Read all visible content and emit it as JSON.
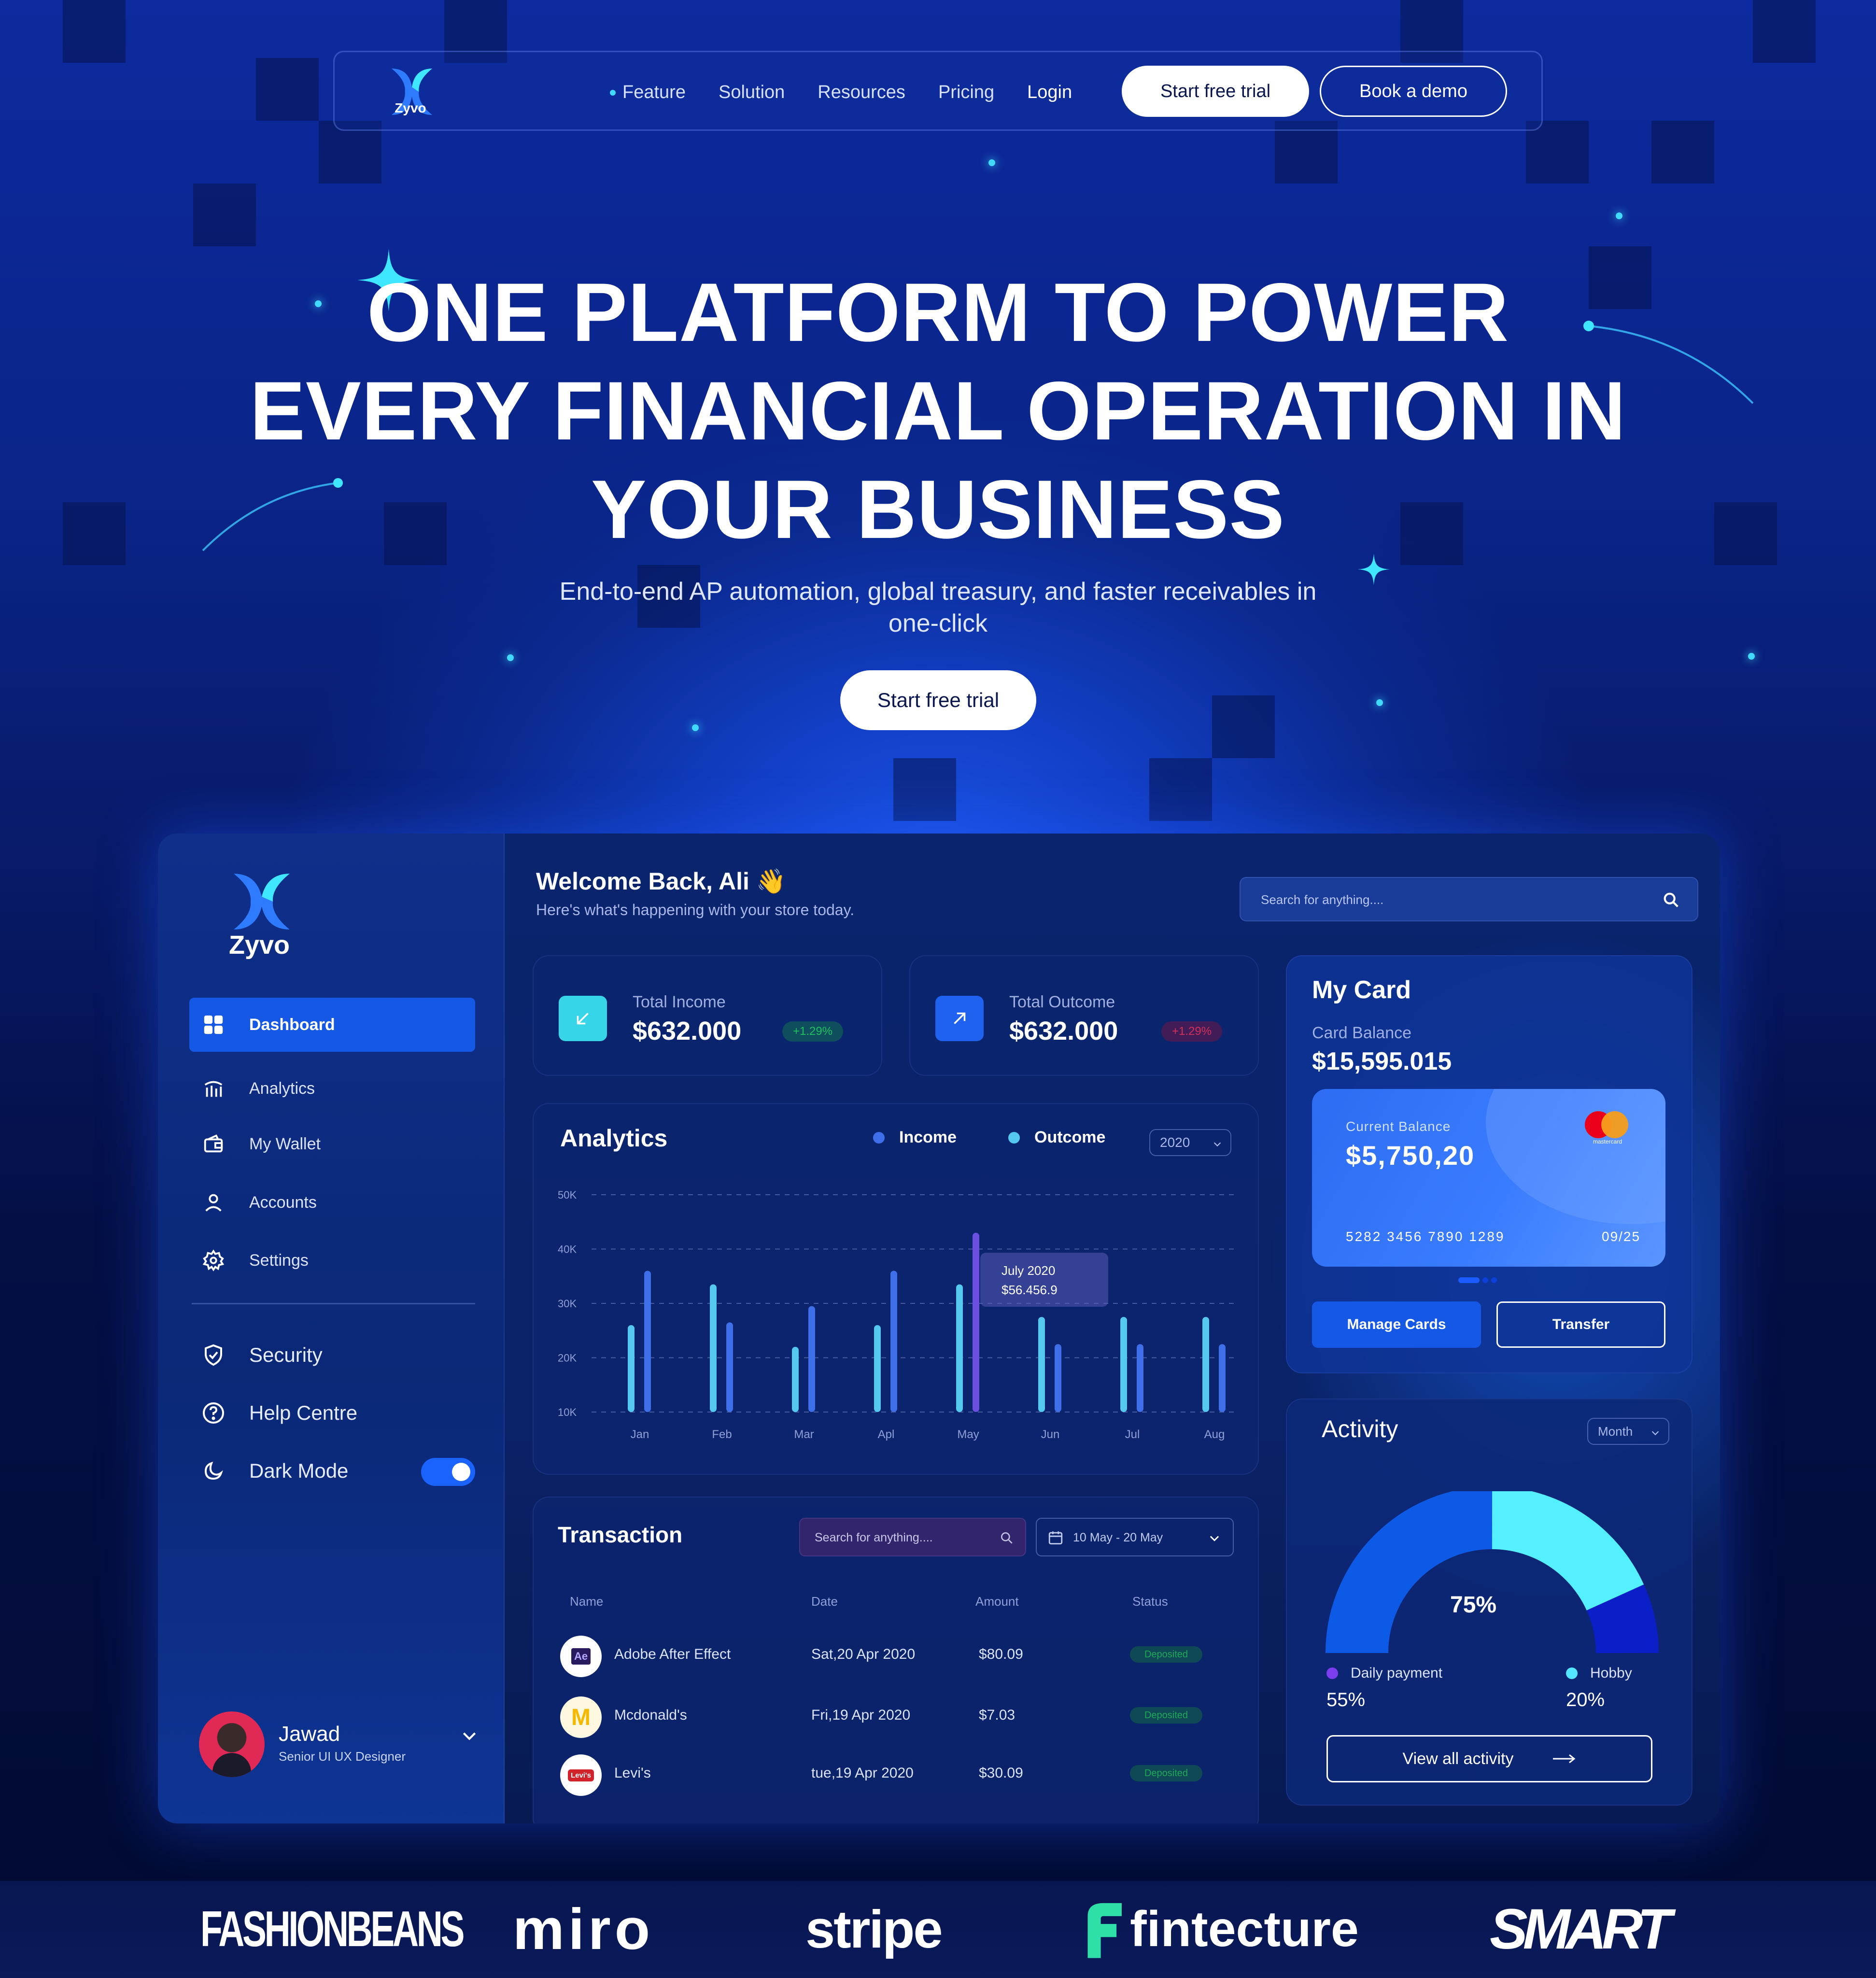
{
  "nav": {
    "logo_text": "Zyvo",
    "links": [
      "Feature",
      "Solution",
      "Resources",
      "Pricing",
      "Login"
    ],
    "cta_primary": "Start free trial",
    "cta_secondary": "Book a demo"
  },
  "hero": {
    "title_line1": "ONE PLATFORM TO POWER",
    "title_line2": "EVERY FINANCIAL OPERATION IN",
    "title_line3": "YOUR BUSINESS",
    "subtitle_line1": "End-to-end AP automation, global treasury, and faster receivables in",
    "subtitle_line2": "one-click",
    "cta": "Start free trial"
  },
  "sidebar": {
    "logo_text": "Zyvo",
    "items": [
      {
        "label": "Dashboard",
        "icon": "grid-icon"
      },
      {
        "label": "Analytics",
        "icon": "bar-chart-icon"
      },
      {
        "label": "My Wallet",
        "icon": "wallet-icon"
      },
      {
        "label": "Accounts",
        "icon": "user-icon"
      },
      {
        "label": "Settings",
        "icon": "gear-icon"
      }
    ],
    "secondary": [
      {
        "label": "Security",
        "icon": "shield-icon"
      },
      {
        "label": "Help Centre",
        "icon": "help-icon"
      },
      {
        "label": "Dark Mode",
        "icon": "moon-icon"
      }
    ],
    "dark_mode_on": true,
    "profile": {
      "name": "Jawad",
      "role": "Senior UI UX Designer"
    }
  },
  "header": {
    "welcome": "Welcome Back, Ali",
    "wave": "👋",
    "subtitle": "Here's what's happening with your store today.",
    "search_placeholder": "Search for anything...."
  },
  "kpis": {
    "income": {
      "label": "Total Income",
      "value": "$632.000",
      "change": "+1.29%"
    },
    "outcome": {
      "label": "Total Outcome",
      "value": "$632.000",
      "change": "+1.29%"
    }
  },
  "analytics": {
    "title": "Analytics",
    "legend_income": "Income",
    "legend_outcome": "Outcome",
    "year": "2020",
    "tooltip_title": "July 2020",
    "tooltip_value": "$56.456.9",
    "colors": {
      "income": "#3f6fe8",
      "outcome": "#55c8f0",
      "highlight": "#6b4fe0"
    }
  },
  "chart_data": {
    "type": "bar",
    "categories": [
      "Jan",
      "Feb",
      "Mar",
      "Apl",
      "May",
      "Jun",
      "Jul",
      "Aug"
    ],
    "y_ticks": [
      "50K",
      "40K",
      "30K",
      "20K",
      "10K"
    ],
    "ylim": [
      10000,
      50000
    ],
    "series": [
      {
        "name": "Outcome",
        "values": [
          26000,
          33500,
          22000,
          26000,
          33500,
          27500,
          27500,
          27500
        ]
      },
      {
        "name": "Income",
        "values": [
          36000,
          26500,
          29500,
          36000,
          40500,
          22500,
          22500,
          22500
        ]
      }
    ],
    "highlight": {
      "category": "May",
      "series": "Income"
    },
    "grid": true
  },
  "transactions": {
    "title": "Transaction",
    "search_placeholder": "Search for anything....",
    "date_range": "10 May - 20 May",
    "columns": [
      "Name",
      "Date",
      "Amount",
      "Status"
    ],
    "rows": [
      {
        "name": "Adobe After Effect",
        "logo": "Ae",
        "date": "Sat,20 Apr 2020",
        "amount": "$80.09",
        "status": "Deposited"
      },
      {
        "name": "Mcdonald's",
        "logo": "M",
        "date": "Fri,19 Apr 2020",
        "amount": "$7.03",
        "status": "Deposited"
      },
      {
        "name": "Levi's",
        "logo": "Levi's",
        "date": "tue,19 Apr 2020",
        "amount": "$30.09",
        "status": "Deposited"
      }
    ]
  },
  "my_card": {
    "title": "My Card",
    "balance_label": "Card Balance",
    "balance": "$15,595.015",
    "current_label": "Current Balance",
    "current_value": "$5,750,20",
    "card_number": "5282 3456 7890 1289",
    "expiry": "09/25",
    "brand": "mastercard",
    "manage_label": "Manage Cards",
    "transfer_label": "Transfer"
  },
  "activity": {
    "title": "Activity",
    "period": "Month",
    "gauge_value": "75%",
    "gauge_fraction": 0.75,
    "legend": [
      {
        "label": "Daily payment",
        "value": "55%",
        "color": "#7b3df0"
      },
      {
        "label": "Hobby",
        "value": "20%",
        "color": "#55e6ff"
      }
    ],
    "cta": "View all activity"
  },
  "brands": [
    "FASHIONBEANS",
    "miro",
    "stripe",
    "fintecture",
    "SMART"
  ]
}
